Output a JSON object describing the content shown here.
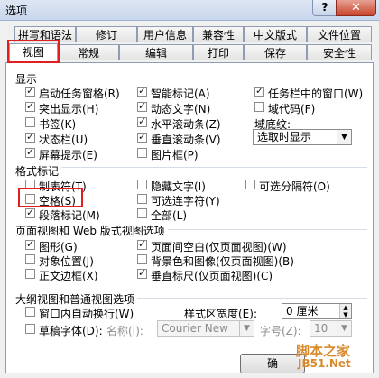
{
  "window": {
    "title": "选项",
    "help": "?",
    "close": "✕"
  },
  "tabs_top": [
    "拼写和语法",
    "修订",
    "用户信息",
    "兼容性",
    "中文版式",
    "文件位置"
  ],
  "tabs_bottom": [
    "视图",
    "常规",
    "编辑",
    "打印",
    "保存",
    "安全性"
  ],
  "display": {
    "title": "显示",
    "items": [
      {
        "label": "启动任务窗格(R)",
        "checked": true
      },
      {
        "label": "智能标记(A)",
        "checked": true
      },
      {
        "label": "任务栏中的窗口(W)",
        "checked": true
      },
      {
        "label": "突出显示(H)",
        "checked": true
      },
      {
        "label": "动态文字(N)",
        "checked": true
      },
      {
        "label": "域代码(F)",
        "checked": false
      },
      {
        "label": "书签(K)",
        "checked": false
      },
      {
        "label": "水平滚动条(Z)",
        "checked": true
      },
      {
        "label": "状态栏(U)",
        "checked": true
      },
      {
        "label": "垂直滚动条(V)",
        "checked": true
      },
      {
        "label": "屏幕提示(E)",
        "checked": true
      },
      {
        "label": "图片框(P)",
        "checked": false
      }
    ],
    "field_shading_label": "域底纹:",
    "field_shading_value": "选取时显示"
  },
  "format_marks": {
    "title": "格式标记",
    "items": [
      {
        "label": "制表符(T)",
        "checked": false
      },
      {
        "label": "隐藏文字(I)",
        "checked": false
      },
      {
        "label": "可选分隔符(O)",
        "checked": false
      },
      {
        "label": "空格(S)",
        "checked": false
      },
      {
        "label": "可选连字符(Y)",
        "checked": false
      },
      {
        "label": "段落标记(M)",
        "checked": true
      },
      {
        "label": "全部(L)",
        "checked": false
      }
    ]
  },
  "page_web": {
    "title": "页面视图和 Web 版式视图选项",
    "items": [
      {
        "label": "图形(G)",
        "checked": true
      },
      {
        "label": "页面间空白(仅页面视图)(W)",
        "checked": true
      },
      {
        "label": "对象位置(J)",
        "checked": false
      },
      {
        "label": "背景色和图像(仅页面视图)(B)",
        "checked": false
      },
      {
        "label": "正文边框(X)",
        "checked": false
      },
      {
        "label": "垂直标尺(仅页面视图)(C)",
        "checked": true
      }
    ]
  },
  "outline": {
    "title": "大纲视图和普通视图选项",
    "items": [
      {
        "label": "窗口内自动换行(W)",
        "checked": false
      },
      {
        "label": "草稿字体(D):",
        "checked": false
      }
    ],
    "style_width_label": "样式区宽度(E):",
    "style_width_value": "0 厘米",
    "font_name_label": "名称(I):",
    "font_name_value": "Courier New",
    "font_size_label": "字号(Z):",
    "font_size_value": "10"
  },
  "buttons": {
    "ok": "确"
  },
  "watermark": {
    "line1": "脚本之家",
    "line2": "JB51.Net"
  }
}
